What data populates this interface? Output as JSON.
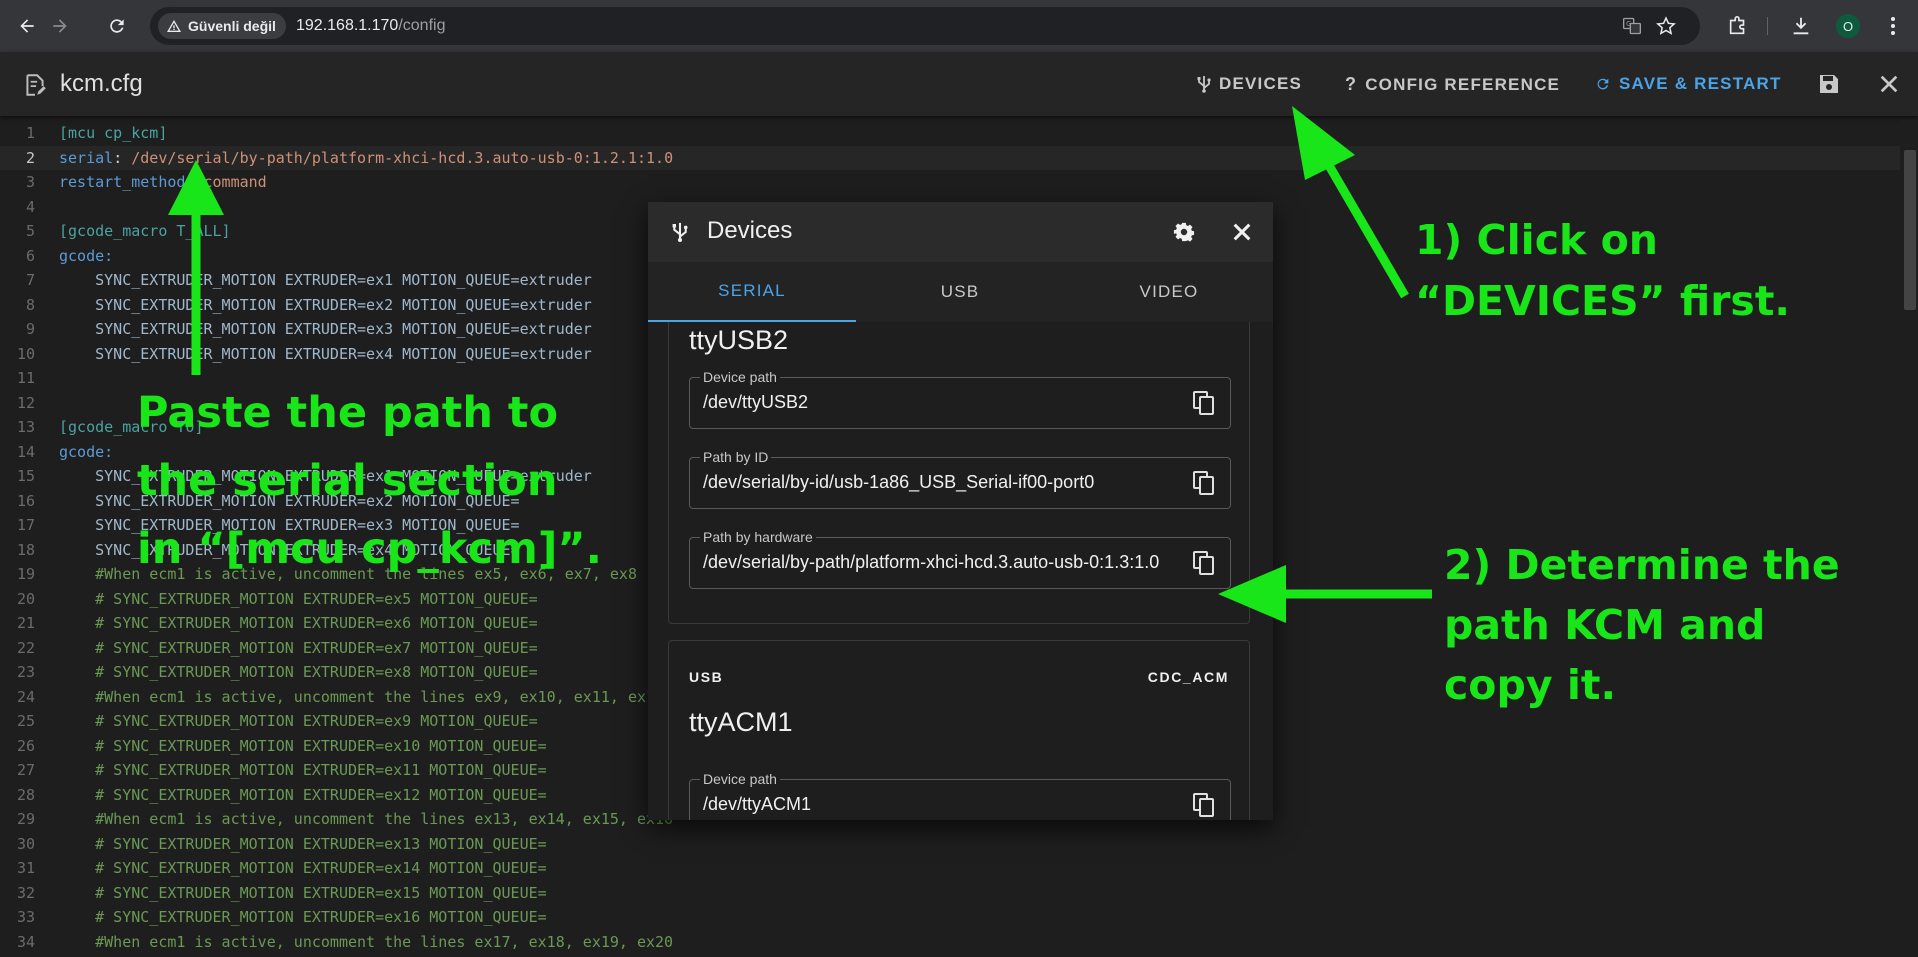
{
  "browser": {
    "security_label": "Güvenli değil",
    "url_host": "192.168.1.170",
    "url_path": "/config",
    "profile_initial": "O"
  },
  "editor": {
    "file_name": "kcm.cfg",
    "devices_label": "DEVICES",
    "config_reference_label": "CONFIG REFERENCE",
    "save_restart_label": "SAVE & RESTART",
    "accent_color": "#4ba3e8",
    "lines": [
      {
        "n": "1",
        "parts": [
          {
            "t": "[mcu cp_kcm]",
            "c": "#4aa3a0"
          }
        ]
      },
      {
        "n": "2",
        "parts": [
          {
            "t": "serial",
            "c": "#5c9bd6"
          },
          {
            "t": ": ",
            "c": "#d4d4d4"
          },
          {
            "t": "/dev/serial/by-path/platform-xhci-hcd.3.auto-usb-0:1.2.1:1.0",
            "c": "#ce9178"
          }
        ]
      },
      {
        "n": "3",
        "parts": [
          {
            "t": "restart_method",
            "c": "#5c9bd6"
          },
          {
            "t": ": ",
            "c": "#d4d4d4"
          },
          {
            "t": "command",
            "c": "#ce9178"
          }
        ]
      },
      {
        "n": "4",
        "parts": []
      },
      {
        "n": "5",
        "parts": [
          {
            "t": "[gcode_macro T_ALL]",
            "c": "#4aa3a0"
          }
        ]
      },
      {
        "n": "6",
        "parts": [
          {
            "t": "gcode:",
            "c": "#5c9bd6"
          }
        ]
      },
      {
        "n": "7",
        "parts": [
          {
            "t": "    SYNC_EXTRUDER_MOTION EXTRUDER=ex1 MOTION_QUEUE=extruder",
            "c": "#9fb8cc"
          }
        ]
      },
      {
        "n": "8",
        "parts": [
          {
            "t": "    SYNC_EXTRUDER_MOTION EXTRUDER=ex2 MOTION_QUEUE=extruder",
            "c": "#9fb8cc"
          }
        ]
      },
      {
        "n": "9",
        "parts": [
          {
            "t": "    SYNC_EXTRUDER_MOTION EXTRUDER=ex3 MOTION_QUEUE=extruder",
            "c": "#9fb8cc"
          }
        ]
      },
      {
        "n": "10",
        "parts": [
          {
            "t": "    SYNC_EXTRUDER_MOTION EXTRUDER=ex4 MOTION_QUEUE=extruder",
            "c": "#9fb8cc"
          }
        ]
      },
      {
        "n": "11",
        "parts": []
      },
      {
        "n": "12",
        "parts": []
      },
      {
        "n": "13",
        "parts": [
          {
            "t": "[gcode_macro T0]",
            "c": "#4aa3a0"
          }
        ]
      },
      {
        "n": "14",
        "parts": [
          {
            "t": "gcode:",
            "c": "#5c9bd6"
          }
        ]
      },
      {
        "n": "15",
        "parts": [
          {
            "t": "    SYNC_EXTRUDER_MOTION EXTRUDER=ex1 MOTION_QUEUE=extruder",
            "c": "#9fb8cc"
          }
        ]
      },
      {
        "n": "16",
        "parts": [
          {
            "t": "    SYNC_EXTRUDER_MOTION EXTRUDER=ex2 MOTION_QUEUE=",
            "c": "#9fb8cc"
          }
        ]
      },
      {
        "n": "17",
        "parts": [
          {
            "t": "    SYNC_EXTRUDER_MOTION EXTRUDER=ex3 MOTION_QUEUE=",
            "c": "#9fb8cc"
          }
        ]
      },
      {
        "n": "18",
        "parts": [
          {
            "t": "    SYNC_EXTRUDER_MOTION EXTRUDER=ex4 MOTION_QUEUE=",
            "c": "#9fb8cc"
          }
        ]
      },
      {
        "n": "19",
        "parts": [
          {
            "t": "    #When ecm1 is active, uncomment the lines ex5, ex6, ex7, ex8",
            "c": "#6a9955"
          }
        ]
      },
      {
        "n": "20",
        "parts": [
          {
            "t": "    # SYNC_EXTRUDER_MOTION EXTRUDER=ex5 MOTION_QUEUE=",
            "c": "#6a9955"
          }
        ]
      },
      {
        "n": "21",
        "parts": [
          {
            "t": "    # SYNC_EXTRUDER_MOTION EXTRUDER=ex6 MOTION_QUEUE=",
            "c": "#6a9955"
          }
        ]
      },
      {
        "n": "22",
        "parts": [
          {
            "t": "    # SYNC_EXTRUDER_MOTION EXTRUDER=ex7 MOTION_QUEUE=",
            "c": "#6a9955"
          }
        ]
      },
      {
        "n": "23",
        "parts": [
          {
            "t": "    # SYNC_EXTRUDER_MOTION EXTRUDER=ex8 MOTION_QUEUE=",
            "c": "#6a9955"
          }
        ]
      },
      {
        "n": "24",
        "parts": [
          {
            "t": "    #When ecm1 is active, uncomment the lines ex9, ex10, ex11, ex12",
            "c": "#6a9955"
          }
        ]
      },
      {
        "n": "25",
        "parts": [
          {
            "t": "    # SYNC_EXTRUDER_MOTION EXTRUDER=ex9 MOTION_QUEUE=",
            "c": "#6a9955"
          }
        ]
      },
      {
        "n": "26",
        "parts": [
          {
            "t": "    # SYNC_EXTRUDER_MOTION EXTRUDER=ex10 MOTION_QUEUE=",
            "c": "#6a9955"
          }
        ]
      },
      {
        "n": "27",
        "parts": [
          {
            "t": "    # SYNC_EXTRUDER_MOTION EXTRUDER=ex11 MOTION_QUEUE=",
            "c": "#6a9955"
          }
        ]
      },
      {
        "n": "28",
        "parts": [
          {
            "t": "    # SYNC_EXTRUDER_MOTION EXTRUDER=ex12 MOTION_QUEUE=",
            "c": "#6a9955"
          }
        ]
      },
      {
        "n": "29",
        "parts": [
          {
            "t": "    #When ecm1 is active, uncomment the lines ex13, ex14, ex15, ex16",
            "c": "#6a9955"
          }
        ]
      },
      {
        "n": "30",
        "parts": [
          {
            "t": "    # SYNC_EXTRUDER_MOTION EXTRUDER=ex13 MOTION_QUEUE=",
            "c": "#6a9955"
          }
        ]
      },
      {
        "n": "31",
        "parts": [
          {
            "t": "    # SYNC_EXTRUDER_MOTION EXTRUDER=ex14 MOTION_QUEUE=",
            "c": "#6a9955"
          }
        ]
      },
      {
        "n": "32",
        "parts": [
          {
            "t": "    # SYNC_EXTRUDER_MOTION EXTRUDER=ex15 MOTION_QUEUE=",
            "c": "#6a9955"
          }
        ]
      },
      {
        "n": "33",
        "parts": [
          {
            "t": "    # SYNC_EXTRUDER_MOTION EXTRUDER=ex16 MOTION_QUEUE=",
            "c": "#6a9955"
          }
        ]
      },
      {
        "n": "34",
        "parts": [
          {
            "t": "    #When ecm1 is active, uncomment the lines ex17, ex18, ex19, ex20",
            "c": "#6a9955"
          }
        ]
      }
    ]
  },
  "dialog": {
    "title": "Devices",
    "tabs": [
      {
        "label": "SERIAL",
        "active": true
      },
      {
        "label": "USB",
        "active": false
      },
      {
        "label": "VIDEO",
        "active": false
      }
    ],
    "device1": {
      "name": "ttyUSB2",
      "device_path_label": "Device path",
      "device_path": "/dev/ttyUSB2",
      "path_by_id_label": "Path by ID",
      "path_by_id": "/dev/serial/by-id/usb-1a86_USB_Serial-if00-port0",
      "path_by_hardware_label": "Path by hardware",
      "path_by_hardware": "/dev/serial/by-path/platform-xhci-hcd.3.auto-usb-0:1.3:1.0"
    },
    "device2": {
      "bus": "USB",
      "driver": "CDC_ACM",
      "name": "ttyACM1",
      "device_path_label": "Device path",
      "device_path": "/dev/ttyACM1"
    }
  },
  "annotations": {
    "color": "#19e619",
    "step1": [
      "1) Click on",
      "“DEVICES” first."
    ],
    "step2": [
      "2) Determine the",
      "path KCM and",
      "copy it."
    ],
    "paste": [
      "Paste the path to",
      "the serial section",
      "in “[mcu cp_kcm]”."
    ]
  }
}
